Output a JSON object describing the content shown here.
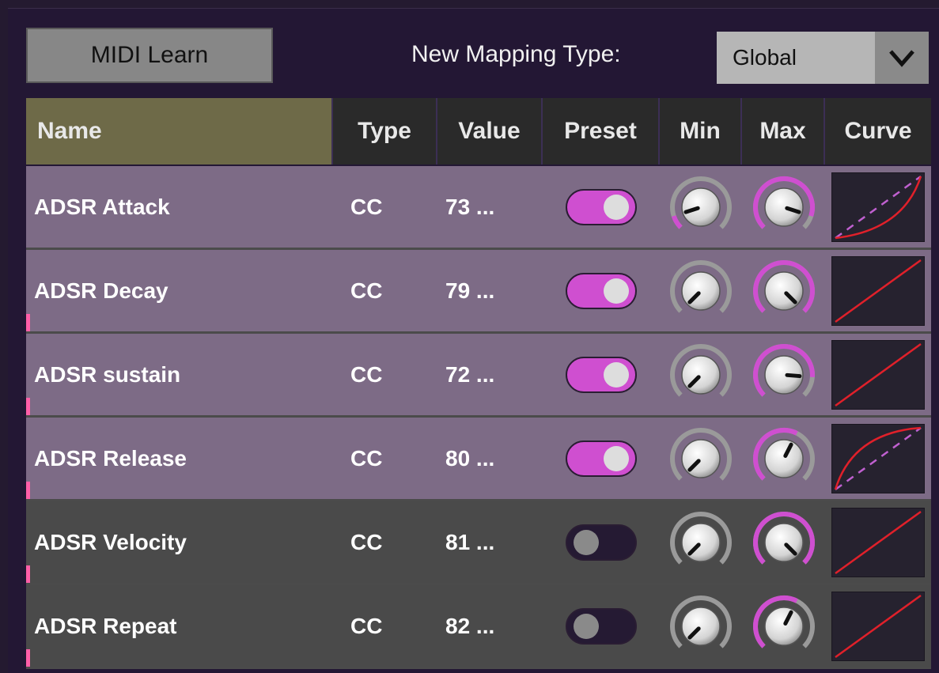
{
  "toolbar": {
    "learn_label": "MIDI Learn",
    "mapping_label": "New Mapping Type:",
    "mapping_value": "Global"
  },
  "columns": [
    "Name",
    "Type",
    "Value",
    "Preset",
    "Min",
    "Max",
    "Curve"
  ],
  "rows": [
    {
      "name": "ADSR Attack",
      "type": "CC",
      "value": "73 ...",
      "preset": true,
      "min": 0.1,
      "max": 0.9,
      "curve": "exp"
    },
    {
      "name": "ADSR Decay",
      "type": "CC",
      "value": "79 ...",
      "preset": true,
      "min": 0.0,
      "max": 1.0,
      "curve": "linear"
    },
    {
      "name": "ADSR sustain",
      "type": "CC",
      "value": "72 ...",
      "preset": true,
      "min": 0.0,
      "max": 0.85,
      "curve": "linear"
    },
    {
      "name": "ADSR Release",
      "type": "CC",
      "value": "80 ...",
      "preset": true,
      "min": 0.0,
      "max": 0.6,
      "curve": "log"
    },
    {
      "name": "ADSR Velocity",
      "type": "CC",
      "value": "81 ...",
      "preset": false,
      "min": 0.0,
      "max": 1.0,
      "curve": "linear"
    },
    {
      "name": "ADSR Repeat",
      "type": "CC",
      "value": "82 ...",
      "preset": false,
      "min": 0.0,
      "max": 0.6,
      "curve": "linear"
    }
  ],
  "colors": {
    "accent": "#cf4fd0",
    "row_active": "#7d6b86",
    "row_inactive": "#4a4a4a",
    "curve_line": "#e0202a",
    "curve_dash": "#c060d0",
    "name_header": "#6e6a48"
  },
  "icons": {
    "dropdown": "chevron-down-icon"
  }
}
